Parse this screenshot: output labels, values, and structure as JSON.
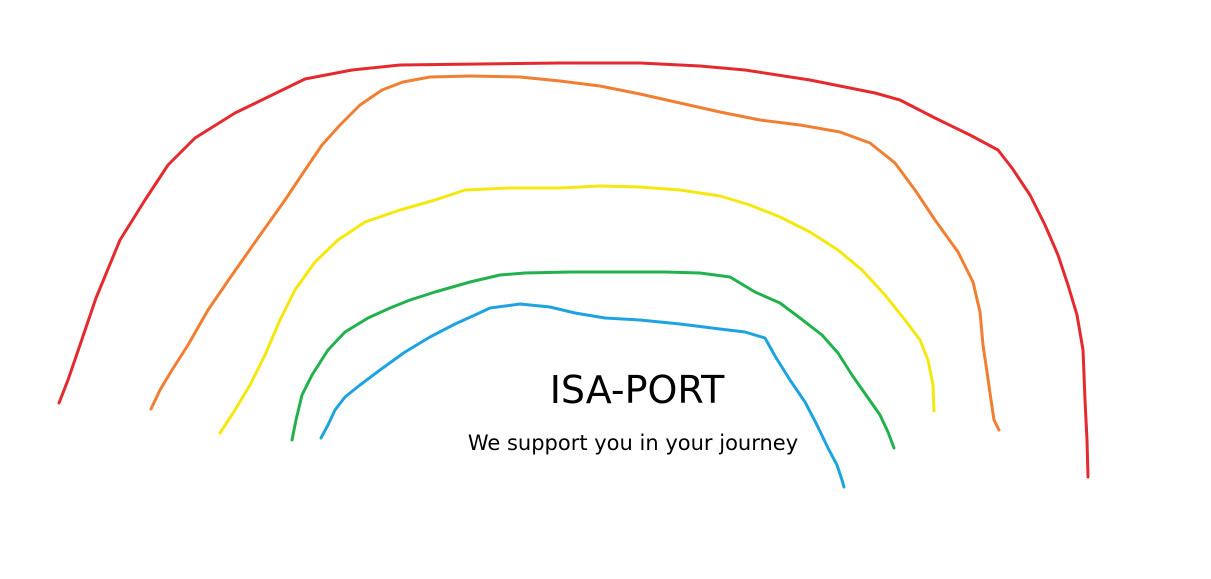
{
  "title": "ISA-PORT",
  "tagline": "We support you in your journey",
  "arcs": [
    {
      "name": "red-arc",
      "color": "#e52a2f"
    },
    {
      "name": "orange-arc",
      "color": "#f07f33"
    },
    {
      "name": "yellow-arc",
      "color": "#f5e80f"
    },
    {
      "name": "green-arc",
      "color": "#22b14c"
    },
    {
      "name": "blue-arc",
      "color": "#1ea3e0"
    }
  ]
}
